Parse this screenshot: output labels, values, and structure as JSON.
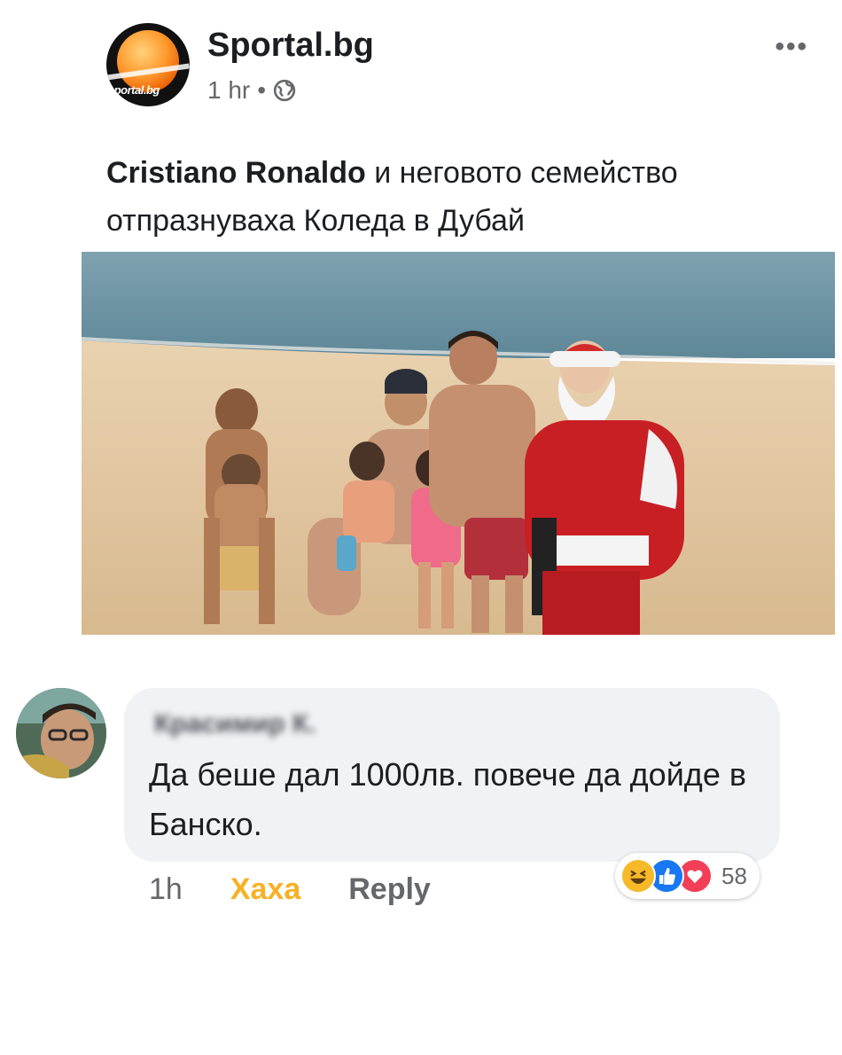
{
  "post": {
    "page_name": "Sportal.bg",
    "avatar_logo_text": "sportal.bg",
    "time": "1 hr",
    "separator": "•",
    "more_label": "•••",
    "caption_tag": "Cristiano Ronaldo",
    "caption_text": " и неговото семейство отпразнуваха Коледа в Дубай"
  },
  "comment": {
    "author": "Красимир К.",
    "text": "Да беше дал 1000лв. повече да дойде в Банско.",
    "time": "1h",
    "reaction_label": "Хаха",
    "reply_label": "Reply",
    "reactions": [
      "haha-icon",
      "like-icon",
      "love-icon"
    ],
    "reaction_count": "58"
  },
  "colors": {
    "haha": "#f7b125",
    "like": "#1877f2",
    "love": "#f33e58",
    "bubble": "#f0f2f5",
    "secondary_text": "#65676b"
  }
}
